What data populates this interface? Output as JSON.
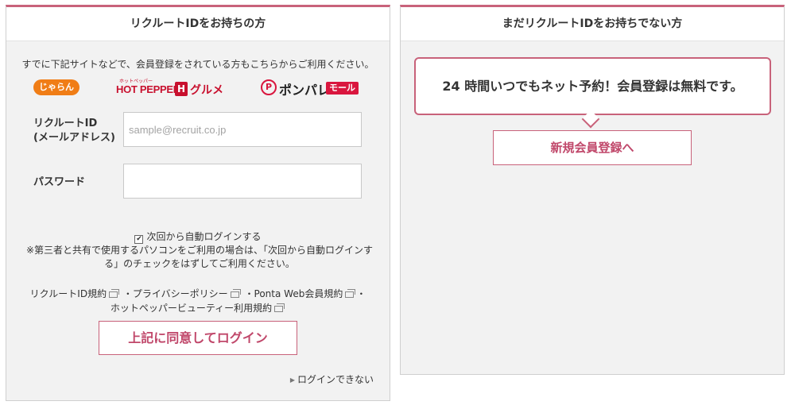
{
  "left_panel": {
    "title": "リクルートIDをお持ちの方",
    "intro": "すでに下記サイトなどで、会員登録をされている方もこちらからご利用ください。",
    "logos": {
      "jalan": "じゃらん",
      "hotpepper_small": "ホットペッパー",
      "hotpepper": "HOT PEPPER",
      "hotpepper_box": "H",
      "gourmet": "グルメ",
      "ponpare_mark": "P",
      "ponpare": "ポンパレ",
      "ponpare_mall": "モール"
    },
    "id_label_1": "リクルートID",
    "id_label_2": "(メールアドレス)",
    "id_placeholder": "sample@recruit.co.jp",
    "password_label": "パスワード",
    "auto_login_checked": "✔",
    "auto_login": "次回から自動ログインする",
    "note": "※第三者と共有で使用するパソコンをご利用の場合は、「次回から自動ログインする」のチェックをはずしてご利用ください。",
    "terms": [
      "リクルートID規約",
      "プライバシーポリシー",
      "Ponta Web会員規約",
      "ホットペッパービューティー利用規約"
    ],
    "separator": "・",
    "login_button": "上記に同意してログイン",
    "cant_login": "ログインできない",
    "cant_login_arrow": "▶"
  },
  "right_panel": {
    "title": "まだリクルートIDをお持ちでない方",
    "bubble": "24 時間いつでもネット予約！会員登録は無料です。",
    "register_button": "新規会員登録へ"
  },
  "colors": {
    "accent": "#c8627a",
    "button_text": "#c0476a",
    "panel_bg": "#f2f2f2"
  }
}
